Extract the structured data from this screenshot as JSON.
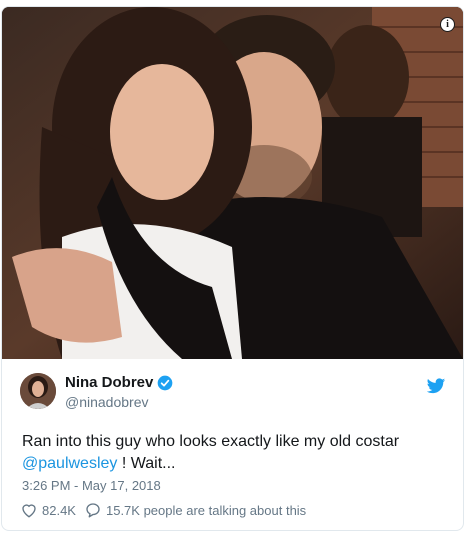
{
  "tweet": {
    "author_name": "Nina Dobrev",
    "author_handle": "@ninadobrev",
    "text_before": "Ran into this guy who looks exactly like my old costar ",
    "mention": "@paulwesley",
    "text_after": " ! Wait...",
    "timestamp": "3:26 PM - May 17, 2018",
    "likes": "82.4K",
    "talking": "15.7K people are talking about this"
  },
  "icons": {
    "info": "info-icon",
    "verified": "verified-badge-icon",
    "bird": "twitter-bird-icon",
    "heart": "heart-icon",
    "reply": "speech-bubble-icon"
  },
  "colors": {
    "link": "#1b95e0",
    "secondary_text": "#657786",
    "border": "#e1e8ed"
  }
}
